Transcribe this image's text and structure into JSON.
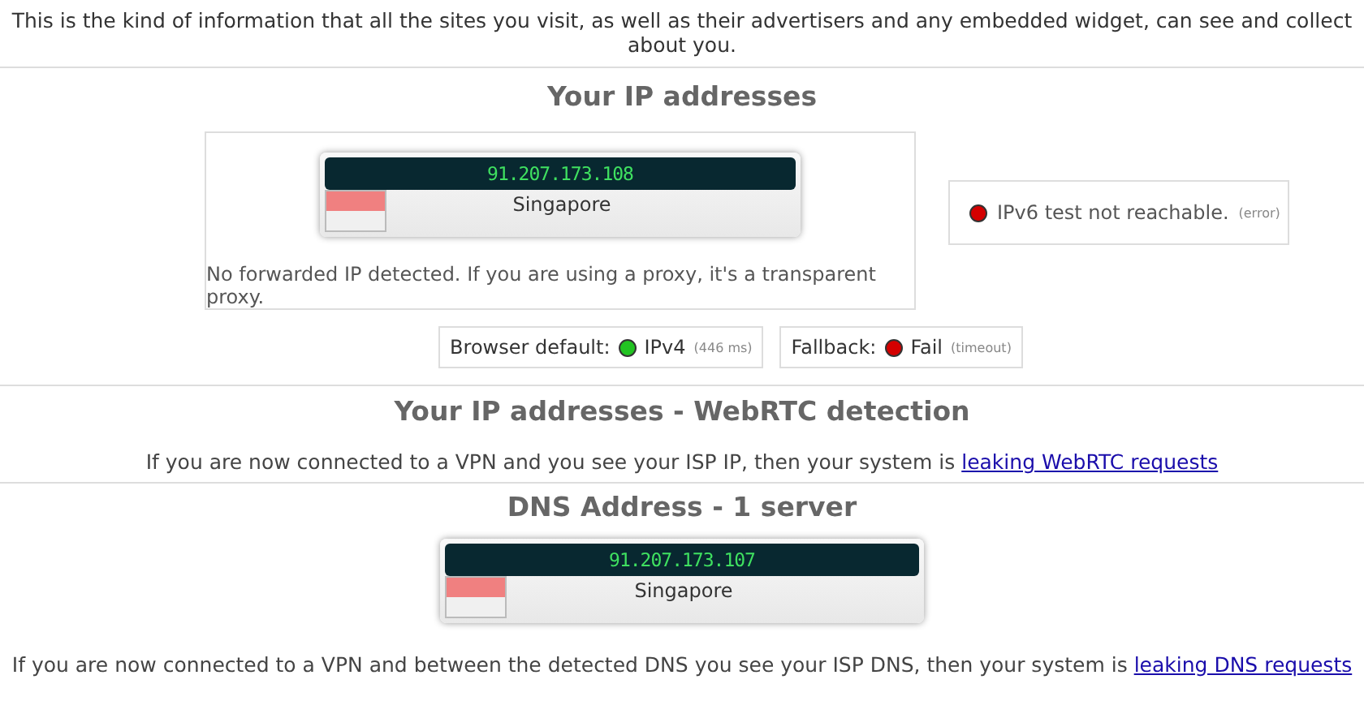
{
  "intro": "This is the kind of information that all the sites you visit, as well as their advertisers and any embedded widget, can see and collect about you.",
  "ip_section": {
    "title": "Your IP addresses",
    "ip_card": {
      "ip": "91.207.173.108",
      "country": "Singapore"
    },
    "note": "No forwarded IP detected. If you are using a proxy, it's a transparent proxy.",
    "ipv6": {
      "color": "#d40000",
      "text": "IPv6 test not reachable.",
      "detail": "(error)"
    },
    "checks": [
      {
        "label": "Browser default:",
        "color": "#22c322",
        "value": "IPv4",
        "detail": "(446 ms)"
      },
      {
        "label": "Fallback:",
        "color": "#d40000",
        "value": "Fail",
        "detail": "(timeout)"
      }
    ]
  },
  "webrtc_section": {
    "title": "Your IP addresses - WebRTC detection",
    "text": "If you are now connected to a VPN and you see your ISP IP, then your system is",
    "link": "leaking WebRTC requests"
  },
  "dns_section": {
    "title": "DNS Address - 1 server",
    "ip_card": {
      "ip": "91.207.173.107",
      "country": "Singapore"
    },
    "text": "If you are now connected to a VPN and between the detected DNS you see your ISP DNS, then your system is",
    "link": "leaking DNS requests"
  }
}
